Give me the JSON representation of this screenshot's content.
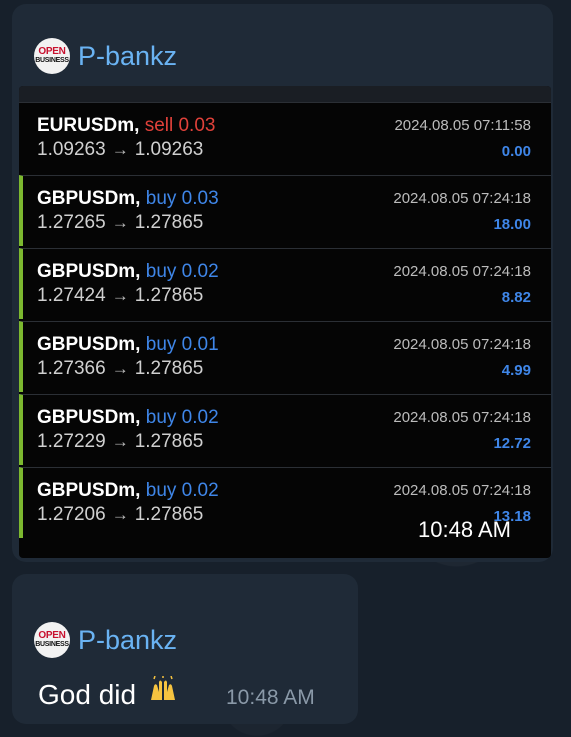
{
  "messages": [
    {
      "sender": "P-bankz",
      "avatar_text_top": "OPEN",
      "avatar_text_bottom": "BUSINESS",
      "time": "10:48 AM",
      "trades": [
        {
          "symbol": "EURUSDm,",
          "side": "sell 0.03",
          "side_type": "sell",
          "open": "1.09263",
          "close": "1.09263",
          "datetime": "2024.08.05 07:11:58",
          "profit": "0.00",
          "accent": false
        },
        {
          "symbol": "GBPUSDm,",
          "side": "buy 0.03",
          "side_type": "buy",
          "open": "1.27265",
          "close": "1.27865",
          "datetime": "2024.08.05 07:24:18",
          "profit": "18.00",
          "accent": true
        },
        {
          "symbol": "GBPUSDm,",
          "side": "buy 0.02",
          "side_type": "buy",
          "open": "1.27424",
          "close": "1.27865",
          "datetime": "2024.08.05 07:24:18",
          "profit": "8.82",
          "accent": true
        },
        {
          "symbol": "GBPUSDm,",
          "side": "buy 0.01",
          "side_type": "buy",
          "open": "1.27366",
          "close": "1.27865",
          "datetime": "2024.08.05 07:24:18",
          "profit": "4.99",
          "accent": true
        },
        {
          "symbol": "GBPUSDm,",
          "side": "buy 0.02",
          "side_type": "buy",
          "open": "1.27229",
          "close": "1.27865",
          "datetime": "2024.08.05 07:24:18",
          "profit": "12.72",
          "accent": true
        },
        {
          "symbol": "GBPUSDm,",
          "side": "buy 0.02",
          "side_type": "buy",
          "open": "1.27206",
          "close": "1.27865",
          "datetime": "2024.08.05 07:24:18",
          "profit": "13.18",
          "accent": true
        }
      ]
    },
    {
      "sender": "P-bankz",
      "avatar_text_top": "OPEN",
      "avatar_text_bottom": "BUSINESS",
      "text": "God did",
      "emoji": "raising-hands",
      "time": "10:48 AM"
    }
  ],
  "arrow_glyph": "→",
  "colors": {
    "background": "#17202b",
    "bubble": "#1f2a37",
    "sender": "#6ab3f3",
    "sell": "#e0413a",
    "buy": "#3f86e8",
    "accent": "#7cb82f"
  }
}
